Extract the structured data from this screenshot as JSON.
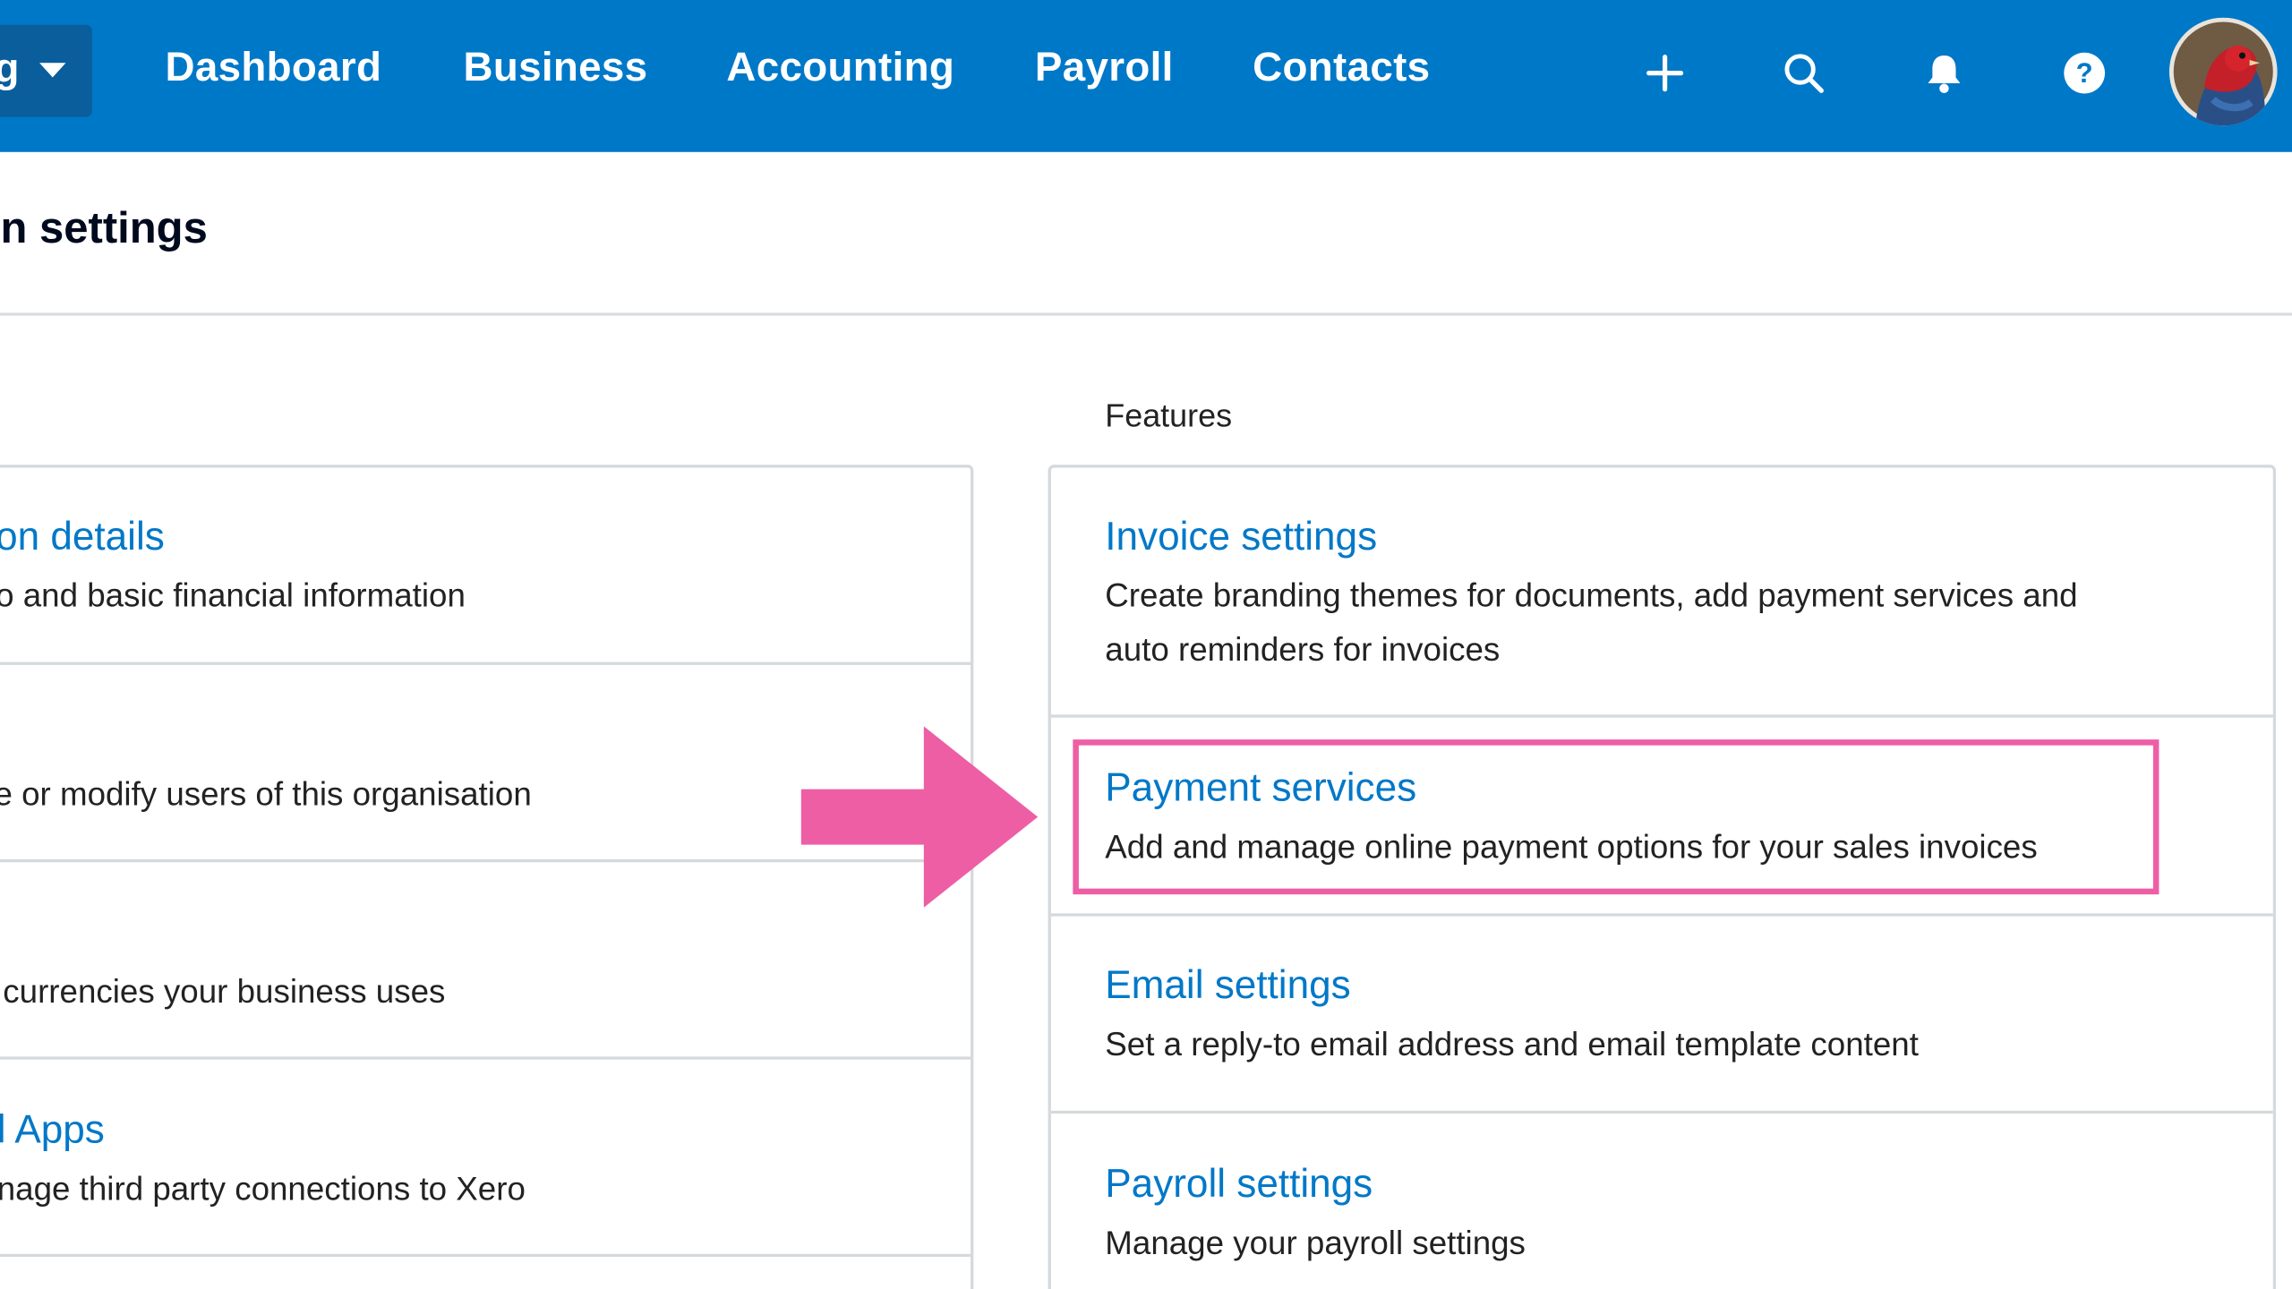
{
  "org": {
    "label_fragment": "g"
  },
  "nav": [
    {
      "label": "Dashboard"
    },
    {
      "label": "Business"
    },
    {
      "label": "Accounting"
    },
    {
      "label": "Payroll"
    },
    {
      "label": "Contacts"
    }
  ],
  "top_icons": [
    "plus-icon",
    "search-icon",
    "bell-icon",
    "help-icon"
  ],
  "page": {
    "title": "on settings"
  },
  "features": {
    "label": "Features"
  },
  "left_items": [
    {
      "title": "on details",
      "desc": "o and basic financial information"
    },
    {
      "title": "",
      "desc": "e or modify users of this organisation"
    },
    {
      "title": "",
      "desc": "currencies your business uses"
    },
    {
      "title": "l Apps",
      "desc": "nage third party connections to Xero"
    }
  ],
  "right_items": [
    {
      "title": "Invoice settings",
      "desc_line1": "Create branding themes for documents, add payment services and",
      "desc_line2": "auto reminders for invoices"
    },
    {
      "title": "Payment services",
      "desc": "Add and manage online payment options for your sales invoices"
    },
    {
      "title": "Email settings",
      "desc": "Set a reply-to email address and email template content"
    },
    {
      "title": "Payroll settings",
      "desc": "Manage your payroll settings"
    }
  ],
  "colors": {
    "brand": "#0078c8",
    "highlight": "#ee5ea5",
    "link": "#0078c8"
  }
}
